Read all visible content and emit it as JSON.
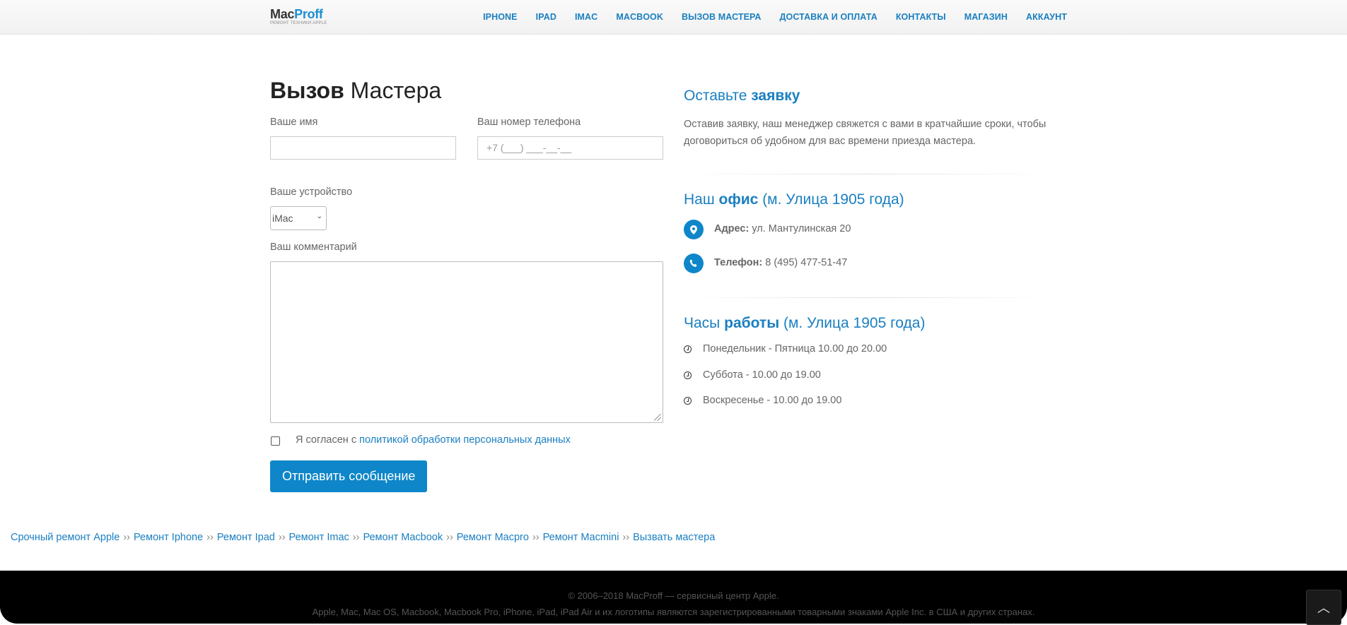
{
  "header": {
    "logo_mac": "Mac",
    "logo_proff": "Proff",
    "logo_sub": "РЕМОНТ ТЕХНИКИ APPLE",
    "nav": [
      "IPHONE",
      "IPAD",
      "IMAC",
      "MACBOOK",
      "ВЫЗОВ МАСТЕРА",
      "ДОСТАВКА И ОПЛАТА",
      "КОНТАКТЫ",
      "МАГАЗИН",
      "АККАУНТ"
    ]
  },
  "form": {
    "title_bold": "Вызов",
    "title_rest": "Мастера",
    "name_label": "Ваше имя",
    "name_value": "",
    "phone_label": "Ваш номер телефона",
    "phone_placeholder": "+7 (___) ___-__-__",
    "device_label": "Ваше устройство",
    "device_value": "iMac",
    "comment_label": "Ваш комментарий",
    "comment_value": "",
    "agree_text": "Я согласен с",
    "agree_link": "политикой обработки персональных данных",
    "agree_checked": false,
    "submit_label": "Отправить сообщение"
  },
  "info": {
    "request_title_plain": "Оставьте",
    "request_title_bold": "заявку",
    "request_text": "Оставив заявку, наш менеджер свяжется с вами в кратчайшие сроки, чтобы договориться об удобном для вас времени приезда мастера.",
    "office_title_plain": "Наш",
    "office_title_bold": "офис",
    "office_title_rest": "(м. Улица 1905 года)",
    "address_label": "Адрес:",
    "address_value": "ул. Мантулинская 20",
    "phone_label": "Телефон:",
    "phone_value": "8 (495) 477-51-47",
    "hours_title_plain": "Часы",
    "hours_title_bold": "работы",
    "hours_title_rest": "(м. Улица 1905 года)",
    "hours": [
      "Понедельник - Пятница 10.00 до 20.00",
      "Суббота - 10.00 до 19.00",
      "Воскресенье - 10.00 до 19.00"
    ]
  },
  "breadcrumbs": {
    "items": [
      "Срочный ремонт Apple",
      "Ремонт Iphone",
      "Ремонт Ipad",
      "Ремонт Imac",
      "Ремонт Macbook",
      "Ремонт Macpro",
      "Ремонт Macmini",
      "Вызвать мастера"
    ],
    "separator": "››"
  },
  "footer": {
    "copyright": "© 2006–2018 MacProff — сервисный центр Apple.",
    "trademark": "Apple, Mac, Mac OS, Macbook, Macbook Pro, iPhone, iPad, iPad Air и их логотипы являются зарегистрированными товарными знаками Apple Inc. в США и других странах."
  },
  "icons": {
    "pin": "map-marker-icon",
    "phone": "phone-icon",
    "clock": "clock-icon",
    "to_top": "chevron-up-icon"
  },
  "colors": {
    "accent": "#0e86c9",
    "link": "#1a7fc1",
    "footer_bg": "#000000"
  }
}
